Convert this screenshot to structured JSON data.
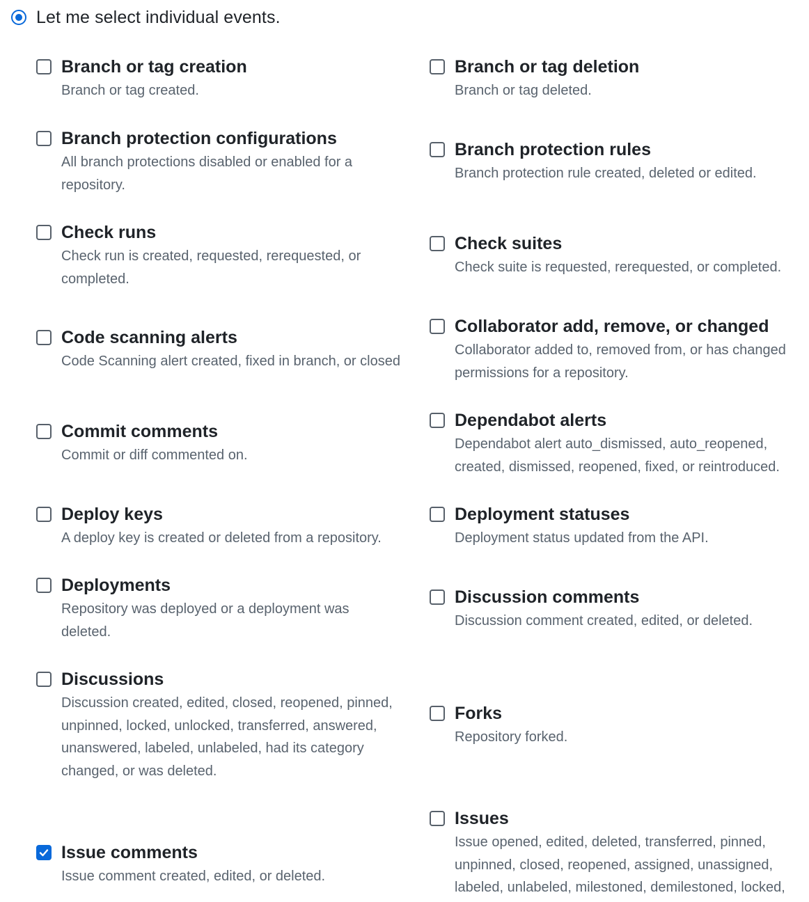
{
  "selection": {
    "label": "Let me select individual events."
  },
  "events_left": [
    {
      "title": "Branch or tag creation",
      "desc": "Branch or tag created.",
      "checked": false
    },
    {
      "title": "Branch protection configurations",
      "desc": "All branch protections disabled or enabled for a repository.",
      "checked": false
    },
    {
      "title": "Check runs",
      "desc": "Check run is created, requested, rerequested, or completed.",
      "checked": false
    },
    {
      "title": "Code scanning alerts",
      "desc": "Code Scanning alert created, fixed in branch, or closed",
      "checked": false
    },
    {
      "title": "Commit comments",
      "desc": "Commit or diff commented on.",
      "checked": false
    },
    {
      "title": "Deploy keys",
      "desc": "A deploy key is created or deleted from a repository.",
      "checked": false
    },
    {
      "title": "Deployments",
      "desc": "Repository was deployed or a deployment was deleted.",
      "checked": false
    },
    {
      "title": "Discussions",
      "desc": "Discussion created, edited, closed, reopened, pinned, unpinned, locked, unlocked, transferred, answered, unanswered, labeled, unlabeled, had its category changed, or was deleted.",
      "checked": false
    },
    {
      "title": "Issue comments",
      "desc": "Issue comment created, edited, or deleted.",
      "checked": true
    }
  ],
  "events_right": [
    {
      "title": "Branch or tag deletion",
      "desc": "Branch or tag deleted.",
      "checked": false
    },
    {
      "title": "Branch protection rules",
      "desc": "Branch protection rule created, deleted or edited.",
      "checked": false
    },
    {
      "title": "Check suites",
      "desc": "Check suite is requested, rerequested, or completed.",
      "checked": false
    },
    {
      "title": "Collaborator add, remove, or changed",
      "desc": "Collaborator added to, removed from, or has changed permissions for a repository.",
      "checked": false
    },
    {
      "title": "Dependabot alerts",
      "desc": "Dependabot alert auto_dismissed, auto_reopened, created, dismissed, reopened, fixed, or reintroduced.",
      "checked": false
    },
    {
      "title": "Deployment statuses",
      "desc": "Deployment status updated from the API.",
      "checked": false
    },
    {
      "title": "Discussion comments",
      "desc": "Discussion comment created, edited, or deleted.",
      "checked": false
    },
    {
      "title": "Forks",
      "desc": "Repository forked.",
      "checked": false
    },
    {
      "title": "Issues",
      "desc": "Issue opened, edited, deleted, transferred, pinned, unpinned, closed, reopened, assigned, unassigned, labeled, unlabeled, milestoned, demilestoned, locked,",
      "checked": false
    }
  ],
  "colors": {
    "accent": "#0969da",
    "text": "#1f2328",
    "muted": "#59636e"
  }
}
